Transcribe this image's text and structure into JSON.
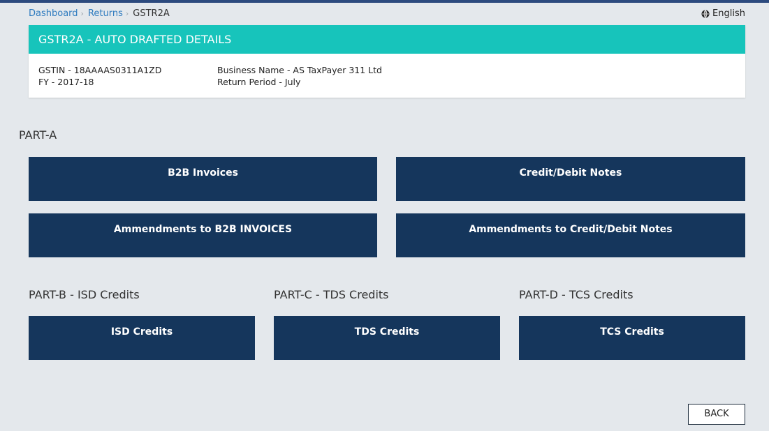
{
  "breadcrumb": {
    "items": [
      "Dashboard",
      "Returns"
    ],
    "current": "GSTR2A"
  },
  "language": {
    "label": "English",
    "icon": "globe-icon"
  },
  "details_card": {
    "title": "GSTR2A - AUTO DRAFTED DETAILS",
    "gstin": "GSTIN - 18AAAAS0311A1ZD",
    "fy": "FY - 2017-18",
    "business_name": "Business Name - AS TaxPayer 311 Ltd",
    "return_period": "Return Period - July"
  },
  "part_a": {
    "heading": "PART-A",
    "tiles": [
      "B2B Invoices",
      "Credit/Debit Notes",
      "Ammendments to B2B INVOICES",
      "Ammendments to Credit/Debit Notes"
    ]
  },
  "part_b": {
    "heading": "PART-B - ISD Credits",
    "tile": "ISD Credits"
  },
  "part_c": {
    "heading": "PART-C - TDS Credits",
    "tile": "TDS Credits"
  },
  "part_d": {
    "heading": "PART-D - TCS Credits",
    "tile": "TCS Credits"
  },
  "actions": {
    "back_label": "BACK"
  },
  "colors": {
    "page_background": "#e4e8ec",
    "header_teal": "#17c4bb",
    "tile_navy": "#15365c",
    "link_blue": "#2e7bbf"
  }
}
